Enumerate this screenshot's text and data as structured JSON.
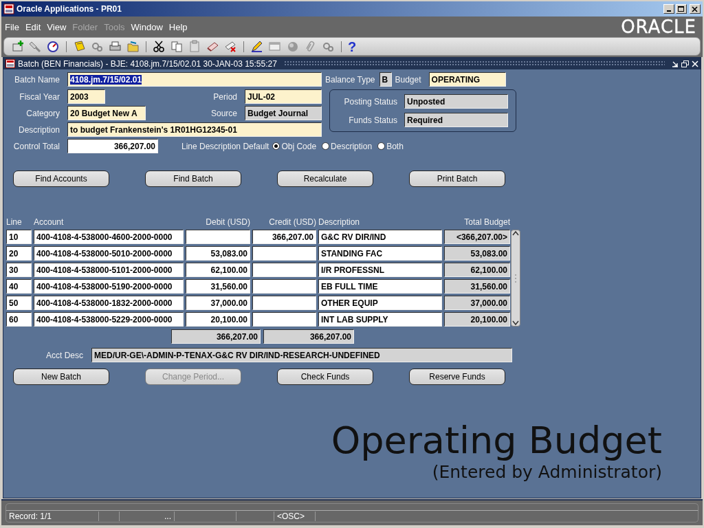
{
  "window": {
    "title": "Oracle Applications - PR01",
    "logo": "ORACLE"
  },
  "menu": [
    {
      "label": "File",
      "disabled": false
    },
    {
      "label": "Edit",
      "disabled": false
    },
    {
      "label": "View",
      "disabled": false
    },
    {
      "label": "Folder",
      "disabled": true
    },
    {
      "label": "Tools",
      "disabled": true
    },
    {
      "label": "Window",
      "disabled": false
    },
    {
      "label": "Help",
      "disabled": false
    }
  ],
  "toolbar": [
    {
      "kind": "new"
    },
    {
      "kind": "find"
    },
    {
      "kind": "navigator"
    },
    {
      "kind": "separator"
    },
    {
      "kind": "save"
    },
    {
      "kind": "gears"
    },
    {
      "kind": "print"
    },
    {
      "kind": "folder"
    },
    {
      "kind": "separator"
    },
    {
      "kind": "cut"
    },
    {
      "kind": "copy"
    },
    {
      "kind": "paste"
    },
    {
      "kind": "eraser"
    },
    {
      "kind": "delete"
    },
    {
      "kind": "separator"
    },
    {
      "kind": "pencil"
    },
    {
      "kind": "window"
    },
    {
      "kind": "sphere"
    },
    {
      "kind": "paperclip"
    },
    {
      "kind": "gears"
    },
    {
      "kind": "separator"
    },
    {
      "kind": "help",
      "glyph": "?"
    }
  ],
  "form": {
    "title": "Batch (BEN Financials) - BJE: 4108.jm.7/15/02.01 30-JAN-03 15:55:27",
    "batch_name": {
      "label": "Batch Name",
      "value": "4108.jm.7/15/02.01",
      "text_selected": true
    },
    "balance_type": {
      "label": "Balance Type",
      "value": "B"
    },
    "budget": {
      "label": "Budget",
      "value": "OPERATING"
    },
    "fiscal_year": {
      "label": "Fiscal Year",
      "value": "2003"
    },
    "period": {
      "label": "Period",
      "value": "JUL-02"
    },
    "category": {
      "label": "Category",
      "value": "20 Budget New A"
    },
    "source": {
      "label": "Source",
      "value": "Budget Journal"
    },
    "description": {
      "label": "Description",
      "value": "to budget Frankenstein's 1R01HG12345-01"
    },
    "posting_status": {
      "label": "Posting Status",
      "value": "Unposted"
    },
    "funds_status": {
      "label": "Funds Status",
      "value": "Required"
    },
    "control_total": {
      "label": "Control Total",
      "value": "366,207.00"
    },
    "line_description_default": {
      "label": "Line Description Default",
      "options": [
        {
          "label": "Obj Code",
          "selected": true
        },
        {
          "label": "Description",
          "selected": false
        },
        {
          "label": "Both",
          "selected": false
        }
      ]
    },
    "top_buttons": [
      {
        "label": "Find Accounts",
        "disabled": false
      },
      {
        "label": "Find Batch",
        "disabled": false
      },
      {
        "label": "Recalculate",
        "disabled": false
      },
      {
        "label": "Print Batch",
        "disabled": false
      }
    ],
    "lines": {
      "columns": [
        "Line",
        "Account",
        "Debit (USD)",
        "Credit (USD)",
        "Description",
        "Total Budget"
      ],
      "rows": [
        {
          "line": "10",
          "account": "400-4108-4-538000-4600-2000-0000",
          "debit": "",
          "credit": "366,207.00",
          "description": "G&C RV DIR/IND",
          "total_budget": "<366,207.00>"
        },
        {
          "line": "20",
          "account": "400-4108-4-538000-5010-2000-0000",
          "debit": "53,083.00",
          "credit": "",
          "description": "STANDING FAC",
          "total_budget": "53,083.00"
        },
        {
          "line": "30",
          "account": "400-4108-4-538000-5101-2000-0000",
          "debit": "62,100.00",
          "credit": "",
          "description": "I/R PROFESSNL",
          "total_budget": "62,100.00"
        },
        {
          "line": "40",
          "account": "400-4108-4-538000-5190-2000-0000",
          "debit": "31,560.00",
          "credit": "",
          "description": "EB FULL TIME",
          "total_budget": "31,560.00"
        },
        {
          "line": "50",
          "account": "400-4108-4-538000-1832-2000-0000",
          "debit": "37,000.00",
          "credit": "",
          "description": "OTHER EQUIP",
          "total_budget": "37,000.00"
        },
        {
          "line": "60",
          "account": "400-4108-4-538000-5229-2000-0000",
          "debit": "20,100.00",
          "credit": "",
          "description": "INT LAB SUPPLY",
          "total_budget": "20,100.00"
        }
      ],
      "totals": {
        "debit": "366,207.00",
        "credit": "366,207.00"
      }
    },
    "acct_desc": {
      "label": "Acct Desc",
      "value": "MED/UR-GE\\-ADMIN-P-TENAX-G&C RV DIR/IND-RESEARCH-UNDEFINED"
    },
    "bottom_buttons": [
      {
        "label": "New Batch",
        "disabled": false
      },
      {
        "label": "Change Period...",
        "disabled": true
      },
      {
        "label": "Check Funds",
        "disabled": false
      },
      {
        "label": "Reserve Funds",
        "disabled": false
      }
    ],
    "banner": {
      "title": "Operating Budget",
      "subtitle": "(Entered by Administrator)"
    }
  },
  "status_bar": {
    "record": "Record: 1/1",
    "segment_3": "...",
    "segment_6": "<OSC>"
  }
}
